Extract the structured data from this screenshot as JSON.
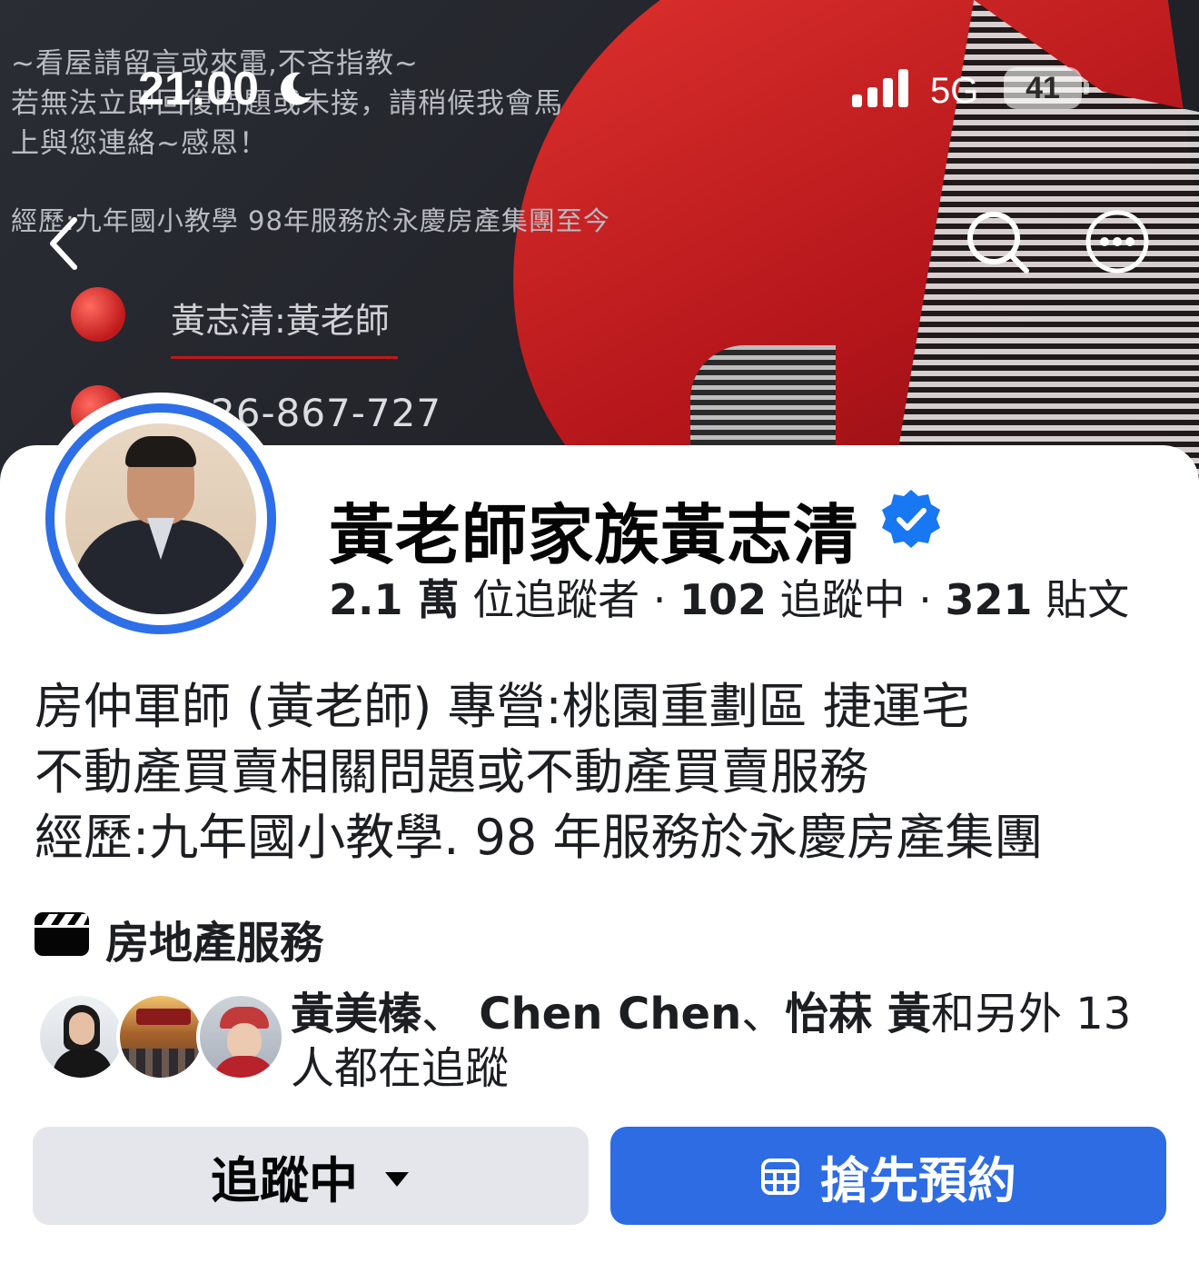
{
  "status_bar": {
    "time": "21:00",
    "network": "5G",
    "battery": "41"
  },
  "cover": {
    "line1": "~看屋請留言或來電,不吝指教~",
    "line2": "若無法立即回復問題或未接，請稍候我會馬",
    "line3": "上與您連絡~感恩！",
    "line4": "經歷:九年國小教學 98年服務於永慶房產集團至今",
    "name_tag": "黃志清:黃老師",
    "phone_partial": "26-867-727"
  },
  "profile": {
    "name": "黃老師家族黃志清",
    "verified": true,
    "stats": {
      "followers_count": "2.1 萬",
      "followers_label": " 位追蹤者",
      "sep1": " · ",
      "following_count": "102",
      "following_label": " 追蹤中",
      "sep2": " · ",
      "posts_count": "321",
      "posts_label": " 貼文"
    },
    "bio": [
      "房仲軍師 (黃老師) 專營:桃園重劃區 捷運宅",
      "不動產買賣相關問題或不動產買賣服務",
      "經歷:九年國小教學. 98 年服務於永慶房產集團"
    ],
    "category": "房地產服務"
  },
  "mutual_followers": {
    "name1": "黃美榛",
    "sep1": "、 ",
    "name2": "Chen Chen",
    "sep2": "、",
    "name3": "怡菻 黃",
    "suffix": "和另外 13 人都在追蹤"
  },
  "buttons": {
    "following": "追蹤中",
    "book": "搶先預約"
  },
  "colors": {
    "accent": "#2d6ce3",
    "verified": "#1877f2",
    "avatar_ring": "#2e6fe8",
    "secondary_button": "#e4e6eb"
  }
}
